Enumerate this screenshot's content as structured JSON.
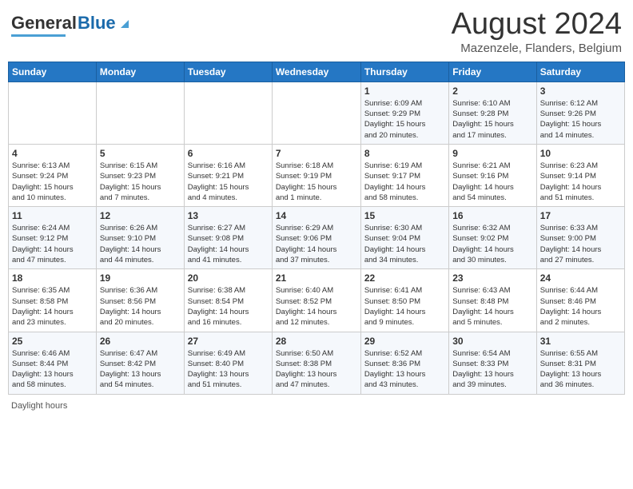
{
  "header": {
    "logo_general": "General",
    "logo_blue": "Blue",
    "month_title": "August 2024",
    "subtitle": "Mazenzele, Flanders, Belgium"
  },
  "days_of_week": [
    "Sunday",
    "Monday",
    "Tuesday",
    "Wednesday",
    "Thursday",
    "Friday",
    "Saturday"
  ],
  "weeks": [
    [
      {
        "day": "",
        "info": ""
      },
      {
        "day": "",
        "info": ""
      },
      {
        "day": "",
        "info": ""
      },
      {
        "day": "",
        "info": ""
      },
      {
        "day": "1",
        "info": "Sunrise: 6:09 AM\nSunset: 9:29 PM\nDaylight: 15 hours\nand 20 minutes."
      },
      {
        "day": "2",
        "info": "Sunrise: 6:10 AM\nSunset: 9:28 PM\nDaylight: 15 hours\nand 17 minutes."
      },
      {
        "day": "3",
        "info": "Sunrise: 6:12 AM\nSunset: 9:26 PM\nDaylight: 15 hours\nand 14 minutes."
      }
    ],
    [
      {
        "day": "4",
        "info": "Sunrise: 6:13 AM\nSunset: 9:24 PM\nDaylight: 15 hours\nand 10 minutes."
      },
      {
        "day": "5",
        "info": "Sunrise: 6:15 AM\nSunset: 9:23 PM\nDaylight: 15 hours\nand 7 minutes."
      },
      {
        "day": "6",
        "info": "Sunrise: 6:16 AM\nSunset: 9:21 PM\nDaylight: 15 hours\nand 4 minutes."
      },
      {
        "day": "7",
        "info": "Sunrise: 6:18 AM\nSunset: 9:19 PM\nDaylight: 15 hours\nand 1 minute."
      },
      {
        "day": "8",
        "info": "Sunrise: 6:19 AM\nSunset: 9:17 PM\nDaylight: 14 hours\nand 58 minutes."
      },
      {
        "day": "9",
        "info": "Sunrise: 6:21 AM\nSunset: 9:16 PM\nDaylight: 14 hours\nand 54 minutes."
      },
      {
        "day": "10",
        "info": "Sunrise: 6:23 AM\nSunset: 9:14 PM\nDaylight: 14 hours\nand 51 minutes."
      }
    ],
    [
      {
        "day": "11",
        "info": "Sunrise: 6:24 AM\nSunset: 9:12 PM\nDaylight: 14 hours\nand 47 minutes."
      },
      {
        "day": "12",
        "info": "Sunrise: 6:26 AM\nSunset: 9:10 PM\nDaylight: 14 hours\nand 44 minutes."
      },
      {
        "day": "13",
        "info": "Sunrise: 6:27 AM\nSunset: 9:08 PM\nDaylight: 14 hours\nand 41 minutes."
      },
      {
        "day": "14",
        "info": "Sunrise: 6:29 AM\nSunset: 9:06 PM\nDaylight: 14 hours\nand 37 minutes."
      },
      {
        "day": "15",
        "info": "Sunrise: 6:30 AM\nSunset: 9:04 PM\nDaylight: 14 hours\nand 34 minutes."
      },
      {
        "day": "16",
        "info": "Sunrise: 6:32 AM\nSunset: 9:02 PM\nDaylight: 14 hours\nand 30 minutes."
      },
      {
        "day": "17",
        "info": "Sunrise: 6:33 AM\nSunset: 9:00 PM\nDaylight: 14 hours\nand 27 minutes."
      }
    ],
    [
      {
        "day": "18",
        "info": "Sunrise: 6:35 AM\nSunset: 8:58 PM\nDaylight: 14 hours\nand 23 minutes."
      },
      {
        "day": "19",
        "info": "Sunrise: 6:36 AM\nSunset: 8:56 PM\nDaylight: 14 hours\nand 20 minutes."
      },
      {
        "day": "20",
        "info": "Sunrise: 6:38 AM\nSunset: 8:54 PM\nDaylight: 14 hours\nand 16 minutes."
      },
      {
        "day": "21",
        "info": "Sunrise: 6:40 AM\nSunset: 8:52 PM\nDaylight: 14 hours\nand 12 minutes."
      },
      {
        "day": "22",
        "info": "Sunrise: 6:41 AM\nSunset: 8:50 PM\nDaylight: 14 hours\nand 9 minutes."
      },
      {
        "day": "23",
        "info": "Sunrise: 6:43 AM\nSunset: 8:48 PM\nDaylight: 14 hours\nand 5 minutes."
      },
      {
        "day": "24",
        "info": "Sunrise: 6:44 AM\nSunset: 8:46 PM\nDaylight: 14 hours\nand 2 minutes."
      }
    ],
    [
      {
        "day": "25",
        "info": "Sunrise: 6:46 AM\nSunset: 8:44 PM\nDaylight: 13 hours\nand 58 minutes."
      },
      {
        "day": "26",
        "info": "Sunrise: 6:47 AM\nSunset: 8:42 PM\nDaylight: 13 hours\nand 54 minutes."
      },
      {
        "day": "27",
        "info": "Sunrise: 6:49 AM\nSunset: 8:40 PM\nDaylight: 13 hours\nand 51 minutes."
      },
      {
        "day": "28",
        "info": "Sunrise: 6:50 AM\nSunset: 8:38 PM\nDaylight: 13 hours\nand 47 minutes."
      },
      {
        "day": "29",
        "info": "Sunrise: 6:52 AM\nSunset: 8:36 PM\nDaylight: 13 hours\nand 43 minutes."
      },
      {
        "day": "30",
        "info": "Sunrise: 6:54 AM\nSunset: 8:33 PM\nDaylight: 13 hours\nand 39 minutes."
      },
      {
        "day": "31",
        "info": "Sunrise: 6:55 AM\nSunset: 8:31 PM\nDaylight: 13 hours\nand 36 minutes."
      }
    ]
  ],
  "footer": {
    "text": "Daylight hours"
  }
}
